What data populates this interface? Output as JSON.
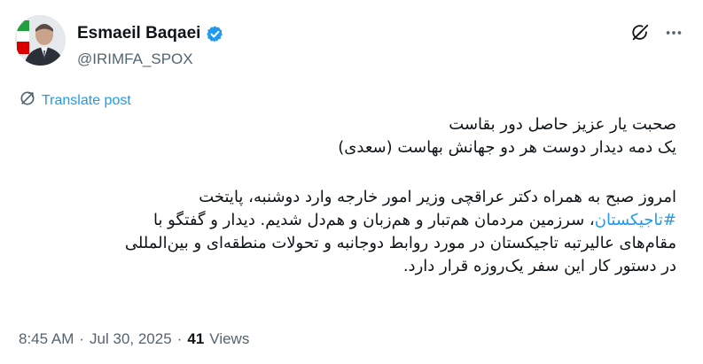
{
  "header": {
    "display_name": "Esmaeil Baqaei",
    "handle": "@IRIMFA_SPOX",
    "verified_icon": "verified-badge-icon",
    "grok_icon": "grok-icon",
    "more_icon": "more-horizontal-icon"
  },
  "translate": {
    "label": "Translate post",
    "icon": "translate-icon"
  },
  "post": {
    "poem_line_1": "صحبت یار عزیز حاصل دور بقاست",
    "poem_line_2": "یک دمه دیدار دوست هر دو جهانش بهاست (سعدی)",
    "para_line_1": "امروز صبح به همراه دکتر عراقچی وزیر امور خارجه وارد دوشنبه، پایتخت",
    "hashtag": "#تاجیکستان",
    "para_line_2_rest": "، سرزمین مردمان هم‌تبار و هم‌زبان و هم‌دل شدیم. دیدار و گفتگو با",
    "para_line_3": "مقام‌های عالیرتبه تاجیکستان در مورد روابط دوجانبه و تحولات منطقه‌ای و بین‌المللی",
    "para_line_4": "در دستور کار این سفر یک‌روزه قرار دارد."
  },
  "meta": {
    "time": "8:45 AM",
    "separator_1": "·",
    "date": "Jul 30, 2025",
    "separator_2": "·",
    "views_count": "41",
    "views_label": "Views"
  },
  "colors": {
    "accent": "#1d9bf0",
    "secondary_text": "#536471",
    "primary_text": "#0f1419"
  }
}
